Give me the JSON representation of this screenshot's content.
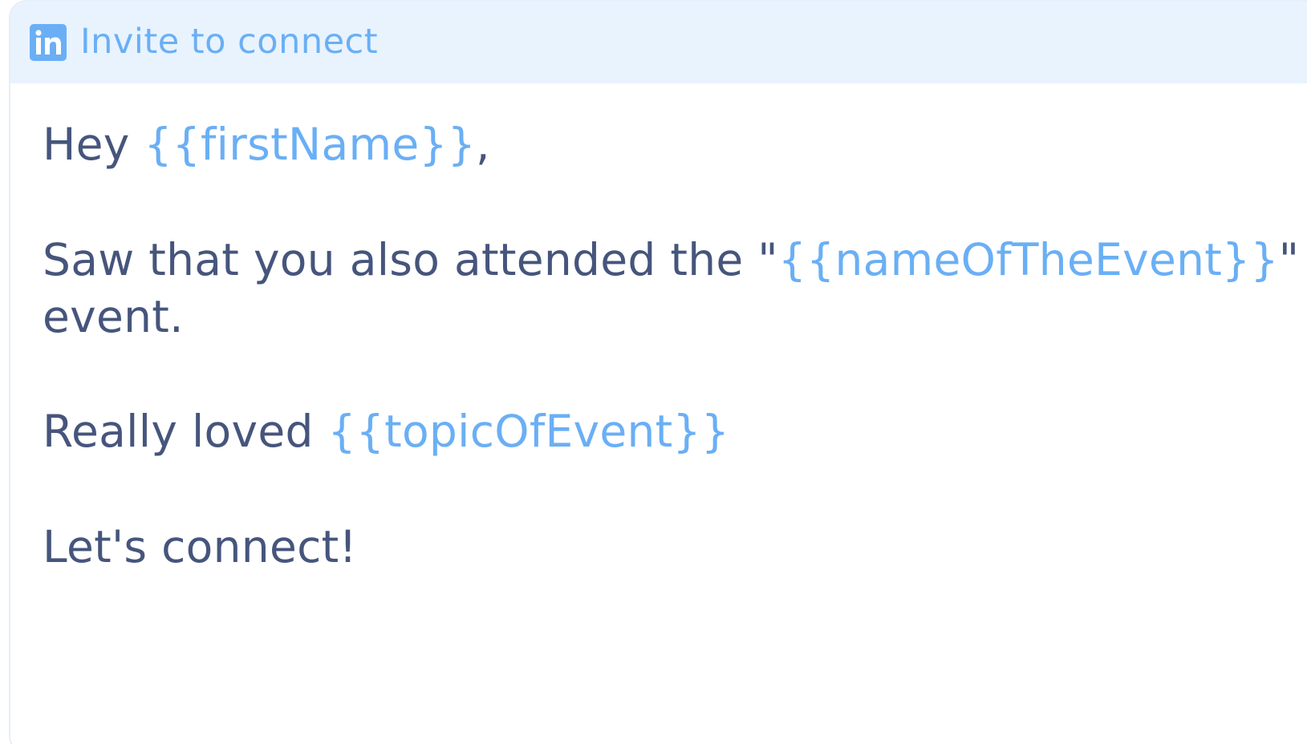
{
  "header": {
    "icon": "linkedin-icon",
    "title": "Invite to connect"
  },
  "message": {
    "greeting_prefix": "Hey ",
    "greeting_var": "{{firstName}}",
    "greeting_suffix": ",",
    "line2_prefix": "Saw that you also attended the \"",
    "line2_var": "{{nameOfTheEvent}}",
    "line2_suffix": "\"",
    "line3": "event.",
    "line4_prefix": "Really loved ",
    "line4_var": "{{topicOfEvent}}",
    "line5": "Let's connect!"
  },
  "colors": {
    "accent": "#6aaff5",
    "text": "#46557c",
    "header_bg": "#e8f3fe"
  }
}
